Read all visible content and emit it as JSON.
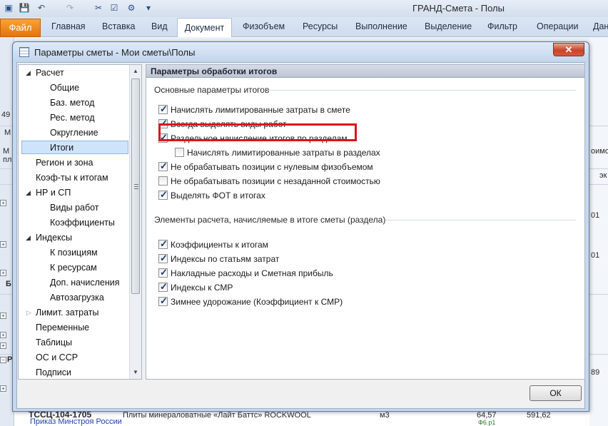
{
  "app": {
    "title": "ГРАНД-Смета - Полы",
    "file_tab": "Файл",
    "tabs": [
      "Главная",
      "Вставка",
      "Вид",
      "Документ",
      "Физобъем",
      "Ресурсы",
      "Выполнение",
      "Выделение",
      "Фильтр",
      "Операции",
      "Дан"
    ],
    "active_tab": "Документ",
    "background_texts": {
      "row_number": "49",
      "code": "ТССЦ-104-1705",
      "description": "Плиты минераловатные «Лайт Баттс» ROCKWOOL",
      "unit": "м3",
      "value1": "64,57",
      "value2": "591,62",
      "footnote": "Приказ Минстроя России",
      "f6": "Ф6.р1",
      "col_right": "оимо",
      "col_right2": "эк",
      "n1": "01",
      "n2": "01",
      "n3": "89",
      "side_letter": "М",
      "side_letter2": "М",
      "side_b": "Б",
      "side_r": "Р",
      "side_pl": "пл"
    }
  },
  "dialog": {
    "title": "Параметры сметы - Мои сметы\\Полы",
    "close_label": "✕",
    "ok_label": "ОК",
    "tree": [
      {
        "label": "Расчет",
        "level": 0,
        "expander": "expanded"
      },
      {
        "label": "Общие",
        "level": 1
      },
      {
        "label": "Баз. метод",
        "level": 1
      },
      {
        "label": "Рес. метод",
        "level": 1
      },
      {
        "label": "Округление",
        "level": 1
      },
      {
        "label": "Итоги",
        "level": 1,
        "selected": true
      },
      {
        "label": "Регион и зона",
        "level": 0
      },
      {
        "label": "Коэф-ты к итогам",
        "level": 0
      },
      {
        "label": "НР и СП",
        "level": 0,
        "expander": "expanded"
      },
      {
        "label": "Виды работ",
        "level": 1
      },
      {
        "label": "Коэффициенты",
        "level": 1
      },
      {
        "label": "Индексы",
        "level": 0,
        "expander": "expanded"
      },
      {
        "label": "К позициям",
        "level": 1
      },
      {
        "label": "К ресурсам",
        "level": 1
      },
      {
        "label": "Доп. начисления",
        "level": 1
      },
      {
        "label": "Автозагрузка",
        "level": 1
      },
      {
        "label": "Лимит. затраты",
        "level": 0,
        "expander": "collapsed"
      },
      {
        "label": "Переменные",
        "level": 0
      },
      {
        "label": "Таблицы",
        "level": 0
      },
      {
        "label": "ОС и ССР",
        "level": 0
      },
      {
        "label": "Подписи",
        "level": 0
      }
    ],
    "panel": {
      "header": "Параметры обработки итогов",
      "group1": {
        "title": "Основные параметры итогов",
        "options": [
          {
            "label": "Начислять лимитированные затраты в смете",
            "checked": true,
            "indent": 0
          },
          {
            "label": "Всегда выделять виды работ",
            "checked": true,
            "indent": 0
          },
          {
            "label": "Раздельное начисление итогов по разделам",
            "checked": true,
            "indent": 0,
            "highlighted": true
          },
          {
            "label": "Начислять лимитированные затраты в разделах",
            "checked": false,
            "indent": 1
          },
          {
            "label": "Не обрабатывать позиции с нулевым физобъемом",
            "checked": true,
            "indent": 0
          },
          {
            "label": "Не обрабатывать позиции с незаданной стоимостью",
            "checked": false,
            "indent": 0
          },
          {
            "label": "Выделять ФОТ в итогах",
            "checked": true,
            "indent": 0
          }
        ]
      },
      "group2": {
        "title": "Элементы расчета, начисляемые в итоге сметы (раздела)",
        "options": [
          {
            "label": "Коэффициенты к итогам",
            "checked": true
          },
          {
            "label": "Индексы по статьям затрат",
            "checked": true
          },
          {
            "label": "Накладные расходы и Сметная прибыль",
            "checked": true
          },
          {
            "label": "Индексы к СМР",
            "checked": true
          },
          {
            "label": "Зимнее удорожание (Коэффициент к СМР)",
            "checked": true
          }
        ]
      }
    }
  }
}
